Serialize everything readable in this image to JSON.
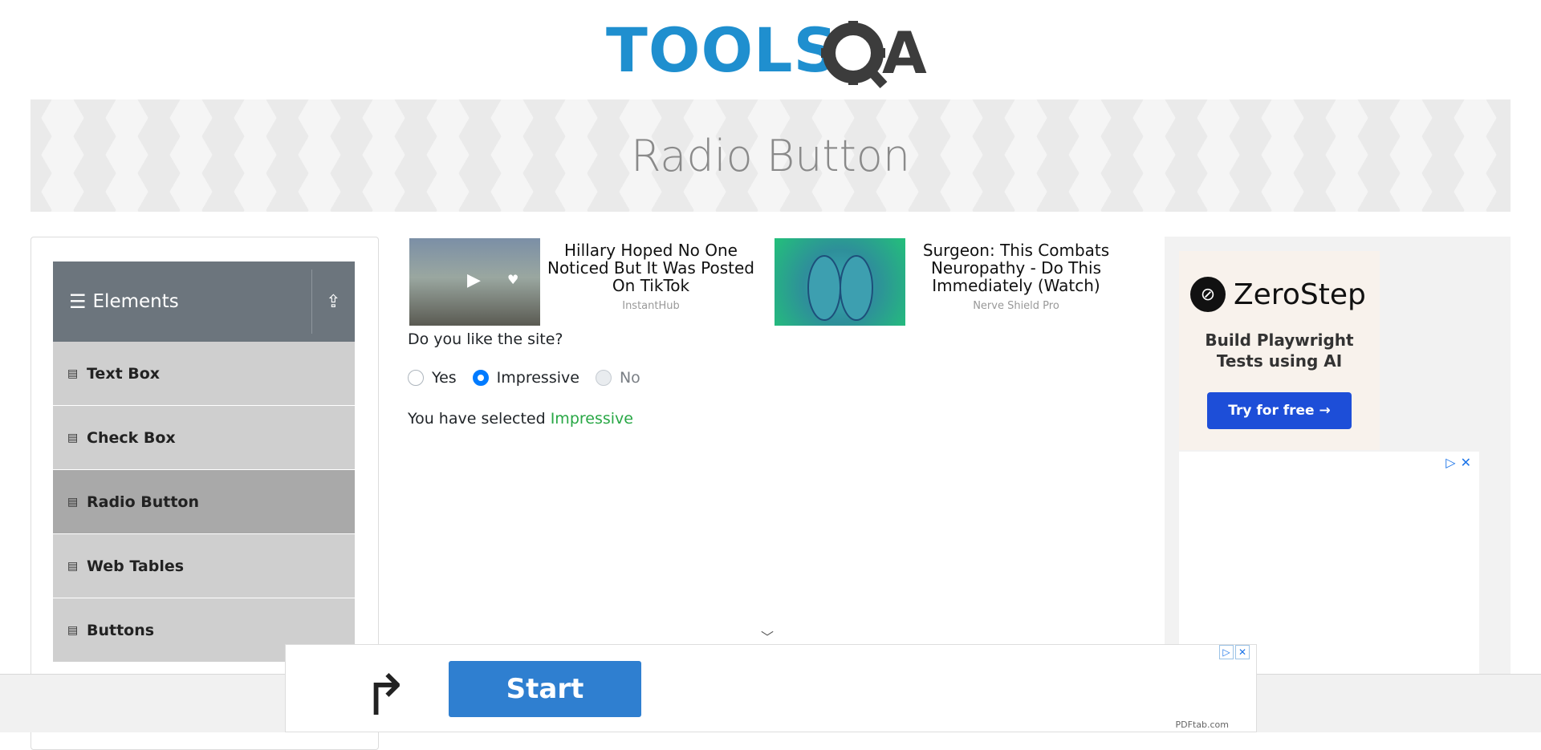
{
  "logo": {
    "text": "TOOLS",
    "suffix": "A"
  },
  "banner": {
    "title": "Radio Button"
  },
  "sidebar": {
    "group": "Elements",
    "items": [
      {
        "label": "Text Box"
      },
      {
        "label": "Check Box"
      },
      {
        "label": "Radio Button",
        "active": true
      },
      {
        "label": "Web Tables"
      },
      {
        "label": "Buttons"
      }
    ]
  },
  "ads": [
    {
      "title": "Hillary Hoped No One Noticed But It Was Posted On TikTok",
      "source": "InstantHub"
    },
    {
      "title": "Surgeon: This Combats Neuropathy - Do This Immediately (Watch)",
      "source": "Nerve Shield Pro"
    }
  ],
  "form": {
    "question": "Do you like the site?",
    "options": [
      "Yes",
      "Impressive",
      "No"
    ],
    "selected": "Impressive",
    "result_prefix": "You have selected",
    "result_value": "Impressive"
  },
  "right_ad": {
    "brand": "ZeroStep",
    "tagline": "Build Playwright Tests using AI",
    "cta": "Try for free →"
  },
  "bottom_ad": {
    "cta": "Start",
    "source": "PDFtab.com"
  },
  "colors": {
    "accent": "#007bff",
    "success": "#28a745",
    "header_bg": "#6c757d",
    "logo_blue": "#1f8fcf"
  }
}
